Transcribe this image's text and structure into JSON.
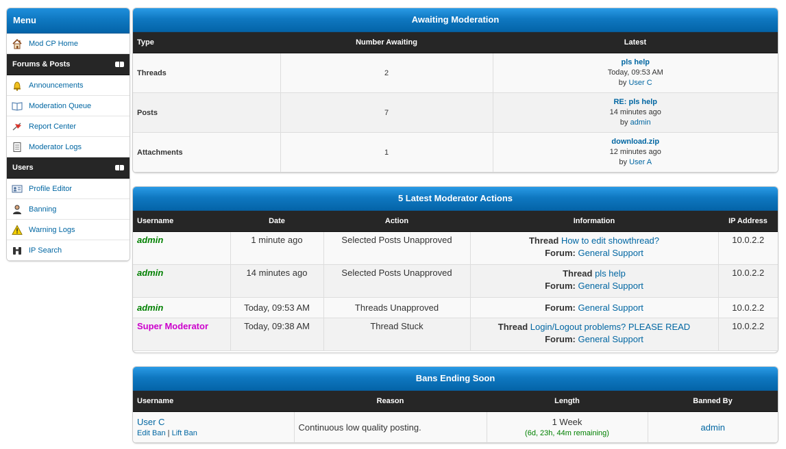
{
  "sidebar": {
    "title": "Menu",
    "home": {
      "label": "Mod CP Home"
    },
    "sections": [
      {
        "title": "Forums & Posts",
        "items": [
          {
            "label": "Announcements"
          },
          {
            "label": "Moderation Queue"
          },
          {
            "label": "Report Center"
          },
          {
            "label": "Moderator Logs"
          }
        ]
      },
      {
        "title": "Users",
        "items": [
          {
            "label": "Profile Editor"
          },
          {
            "label": "Banning"
          },
          {
            "label": "Warning Logs"
          },
          {
            "label": "IP Search"
          }
        ]
      }
    ]
  },
  "awaiting": {
    "title": "Awaiting Moderation",
    "headers": [
      "Type",
      "Number Awaiting",
      "Latest"
    ],
    "rows": [
      {
        "type": "Threads",
        "count": "2",
        "latest_title": "pls help",
        "latest_time": "Today, 09:53 AM",
        "by_label": "by",
        "by_user": "User C"
      },
      {
        "type": "Posts",
        "count": "7",
        "latest_title": "RE: pls help",
        "latest_time": "14 minutes ago",
        "by_label": "by",
        "by_user": "admin"
      },
      {
        "type": "Attachments",
        "count": "1",
        "latest_title": "download.zip",
        "latest_time": "12 minutes ago",
        "by_label": "by",
        "by_user": "User A"
      }
    ]
  },
  "actions": {
    "title": "5 Latest Moderator Actions",
    "headers": [
      "Username",
      "Date",
      "Action",
      "Information",
      "IP Address"
    ],
    "thread_label": "Thread",
    "forum_label": "Forum:",
    "rows": [
      {
        "user": "admin",
        "date": "1 minute ago",
        "action": "Selected Posts Unapproved",
        "thread": "How to edit showthread?",
        "forum": "General Support",
        "ip": "10.0.2.2"
      },
      {
        "user": "admin",
        "date": "14 minutes ago",
        "action": "Selected Posts Unapproved",
        "thread": "pls help",
        "forum": "General Support",
        "ip": "10.0.2.2"
      },
      {
        "user": "admin",
        "date": "Today, 09:53 AM",
        "action": "Threads Unapproved",
        "thread": "",
        "forum": "General Support",
        "ip": "10.0.2.2"
      },
      {
        "user": "Super Moderator",
        "date": "Today, 09:38 AM",
        "action": "Thread Stuck",
        "thread": "Login/Logout problems? PLEASE READ",
        "forum": "General Support",
        "ip": "10.0.2.2"
      }
    ]
  },
  "bans": {
    "title": "Bans Ending Soon",
    "headers": [
      "Username",
      "Reason",
      "Length",
      "Banned By"
    ],
    "rows": [
      {
        "user": "User C",
        "edit": "Edit Ban",
        "sep": "|",
        "lift": "Lift Ban",
        "reason": "Continuous low quality posting.",
        "length": "1 Week",
        "remaining": "(6d, 23h, 44m remaining)",
        "banned_by": "admin"
      }
    ]
  },
  "colors": {
    "accent": "#0f78c1",
    "header_dark": "#262626",
    "link": "#0066a2",
    "admin_user": "#008000",
    "super_mod_user": "#cc00cc"
  }
}
